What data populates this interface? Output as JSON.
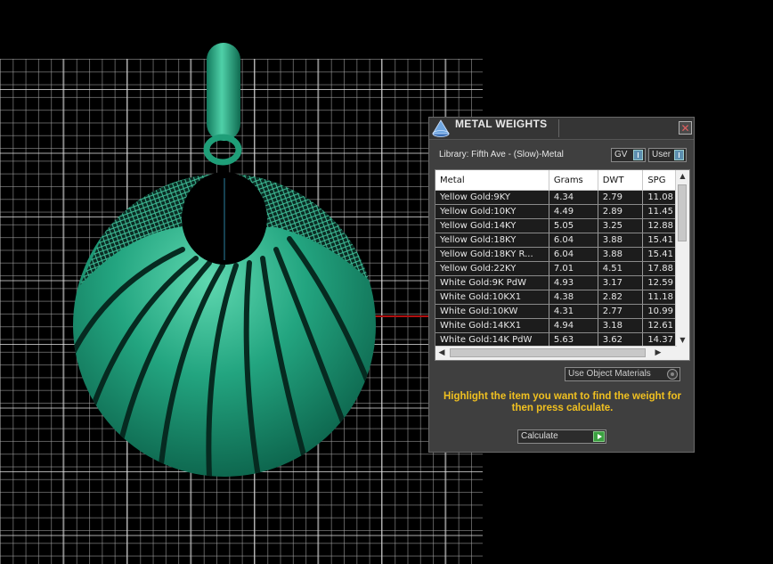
{
  "dialog": {
    "title": "METAL WEIGHTS",
    "close_glyph": "✕",
    "library": "Library: Fifth Ave - (Slow)-Metal",
    "gv_label": "GV",
    "user_label": "User",
    "columns": [
      "Metal",
      "Grams",
      "DWT",
      "SPG"
    ],
    "rows": [
      [
        "Yellow Gold:9KY",
        "4.34",
        "2.79",
        "11.08"
      ],
      [
        "Yellow Gold:10KY",
        "4.49",
        "2.89",
        "11.45"
      ],
      [
        "Yellow Gold:14KY",
        "5.05",
        "3.25",
        "12.88"
      ],
      [
        "Yellow Gold:18KY",
        "6.04",
        "3.88",
        "15.41"
      ],
      [
        "Yellow Gold:18KY R...",
        "6.04",
        "3.88",
        "15.41"
      ],
      [
        "Yellow Gold:22KY",
        "7.01",
        "4.51",
        "17.88"
      ],
      [
        "White Gold:9K PdW",
        "4.93",
        "3.17",
        "12.59"
      ],
      [
        "White Gold:10KX1",
        "4.38",
        "2.82",
        "11.18"
      ],
      [
        "White Gold:10KW",
        "4.31",
        "2.77",
        "10.99"
      ],
      [
        "White Gold:14KX1",
        "4.94",
        "3.18",
        "12.61"
      ],
      [
        "White Gold:14K PdW",
        "5.63",
        "3.62",
        "14.37"
      ]
    ],
    "use_object_materials": "Use Object Materials",
    "hint": "Highlight the item you want to find the weight for then press calculate.",
    "calculate_label": "Calculate"
  },
  "colors": {
    "model": "#1f9e78",
    "hint": "#f0c020",
    "grid": "#aaaaaa",
    "axis_x": "#b01010"
  },
  "icons": {
    "title_icon": "cone-shape-icon",
    "close_icon": "close-icon",
    "calculate_icon": "play-arrow-icon"
  }
}
